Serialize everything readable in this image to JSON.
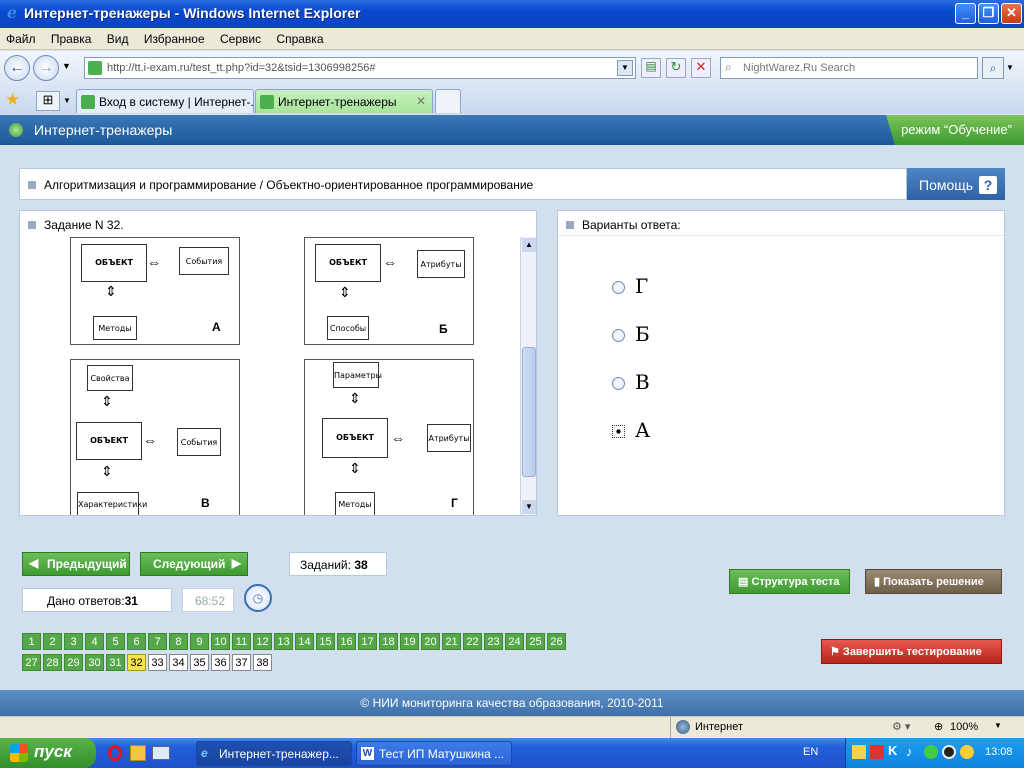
{
  "window": {
    "title": "Интернет-тренажеры - Windows Internet Explorer"
  },
  "menu": [
    "Файл",
    "Правка",
    "Вид",
    "Избранное",
    "Сервис",
    "Справка"
  ],
  "address": {
    "url": "http://tt.i-exam.ru/test_tt.php?id=32&tsid=1306998256#",
    "search_placeholder": "NightWarez.Ru Search"
  },
  "tabs": [
    {
      "label": "Вход в систему | Интернет-..."
    },
    {
      "label": "Интернет-тренажеры"
    }
  ],
  "app": {
    "title": "Интернет-тренажеры",
    "mode": "режим “Обучение”"
  },
  "breadcrumb": "Алгоритмизация и программирование / Объектно-ориентированное программирование",
  "help_label": "Помощь",
  "task": {
    "title": "Задание N 32."
  },
  "diagrams": {
    "a": {
      "obj": "ОБЪЕКТ",
      "right": "События",
      "bottom": "Методы",
      "letter": "А"
    },
    "b": {
      "obj": "ОБЪЕКТ",
      "right": "Атрибуты",
      "bottom": "Способы",
      "letter": "Б"
    },
    "v": {
      "obj": "ОБЪЕКТ",
      "top": "Свойства",
      "right": "События",
      "bottom": "Характеристики",
      "letter": "В"
    },
    "g": {
      "obj": "ОБЪЕКТ",
      "top": "Параметры",
      "right": "Атрибуты",
      "bottom": "Методы",
      "letter": "Г"
    }
  },
  "answers": {
    "title": "Варианты ответа:",
    "options": [
      "Г",
      "Б",
      "В",
      "А"
    ],
    "selected_index": 3
  },
  "nav": {
    "prev": "Предыдущий",
    "next": "Следующий",
    "tasks_label": "Заданий:",
    "tasks_count": "38",
    "answered_label": "Дано ответов:",
    "answered_count": "31",
    "timer": "68:52",
    "structure": "Структура теста",
    "show_solution": "Показать решение",
    "finish": "Завершить тестирование"
  },
  "numbers": {
    "total": 38,
    "answered_through": 31,
    "current": 32
  },
  "footer": "© НИИ мониторинга качества образования, 2010-2011",
  "status": {
    "zone": "Интернет",
    "zoom": "100%"
  },
  "taskbar": {
    "start": "пуск",
    "items": [
      "Интернет-тренажер...",
      "Тест ИП Матушкина ..."
    ],
    "lang": "EN",
    "clock": "13:08"
  }
}
